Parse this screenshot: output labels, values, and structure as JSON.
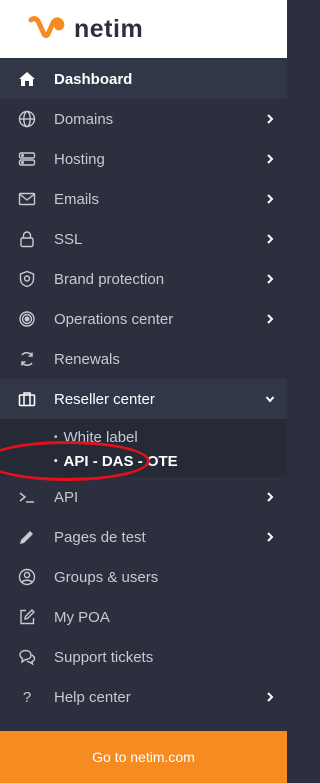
{
  "brand": {
    "name": "netim",
    "accent": "#f68b21"
  },
  "menu": [
    {
      "label": "Dashboard",
      "icon": "home-icon"
    },
    {
      "label": "Domains",
      "icon": "globe-icon"
    },
    {
      "label": "Hosting",
      "icon": "server-icon"
    },
    {
      "label": "Emails",
      "icon": "envelope-icon"
    },
    {
      "label": "SSL",
      "icon": "lock-icon"
    },
    {
      "label": "Brand protection",
      "icon": "shield-icon"
    },
    {
      "label": "Operations center",
      "icon": "target-icon"
    },
    {
      "label": "Renewals",
      "icon": "refresh-icon"
    },
    {
      "label": "Reseller center",
      "icon": "briefcase-icon"
    },
    {
      "label": "API",
      "icon": "terminal-icon"
    },
    {
      "label": "Pages de test",
      "icon": "pencil-icon"
    },
    {
      "label": "Groups & users",
      "icon": "user-circle-icon"
    },
    {
      "label": "My POA",
      "icon": "edit-document-icon"
    },
    {
      "label": "Support tickets",
      "icon": "chat-icon"
    },
    {
      "label": "Help center",
      "icon": "question-icon"
    }
  ],
  "reseller_submenu": [
    {
      "label": "White label"
    },
    {
      "label": "API - DAS - OTE"
    }
  ],
  "footer": {
    "label": "Go to netim.com"
  }
}
